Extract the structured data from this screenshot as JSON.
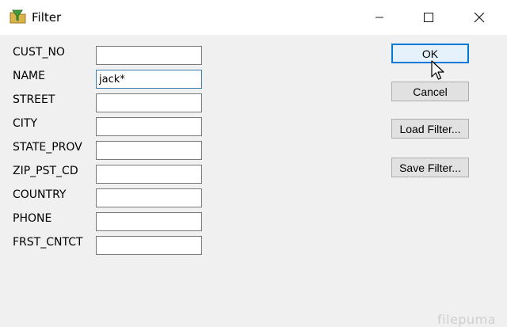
{
  "window": {
    "title": "Filter",
    "icon": "folder-funnel-icon",
    "controls": {
      "minimize": "minimize-icon",
      "maximize": "maximize-icon",
      "close": "close-icon"
    }
  },
  "fields": [
    {
      "label": "CUST_NO",
      "value": ""
    },
    {
      "label": "NAME",
      "value": "jack*"
    },
    {
      "label": "STREET",
      "value": ""
    },
    {
      "label": "CITY",
      "value": ""
    },
    {
      "label": "STATE_PROV",
      "value": ""
    },
    {
      "label": "ZIP_PST_CD",
      "value": ""
    },
    {
      "label": "COUNTRY",
      "value": ""
    },
    {
      "label": "PHONE",
      "value": ""
    },
    {
      "label": "FRST_CNTCT",
      "value": ""
    }
  ],
  "buttons": {
    "ok": "OK",
    "cancel": "Cancel",
    "load_filter": "Load Filter...",
    "save_filter": "Save Filter..."
  },
  "watermark": "filepuma",
  "colors": {
    "accent": "#0078d7",
    "background": "#f0f0f0",
    "titlebar": "#ffffff"
  }
}
